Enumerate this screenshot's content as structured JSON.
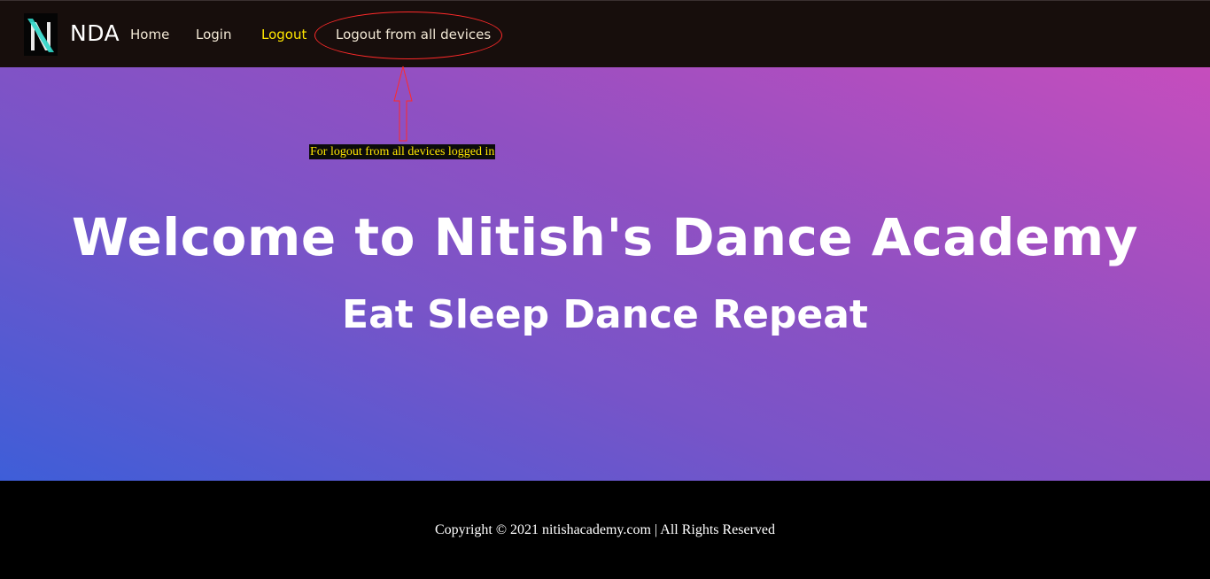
{
  "navbar": {
    "brand": "NDA",
    "logo_letter": "N",
    "links": [
      {
        "label": "Home",
        "active": false
      },
      {
        "label": "Login",
        "active": false
      },
      {
        "label": "Logout",
        "active": true
      },
      {
        "label": "Logout from all devices",
        "active": false
      }
    ]
  },
  "annotation": {
    "note": "For logout from all devices logged in",
    "color": "#ff2a2a"
  },
  "hero": {
    "title": "Welcome to Nitish's Dance Academy",
    "subtitle": "Eat Sleep Dance Repeat",
    "gradient_start": "#3e5ed8",
    "gradient_end": "#c64dbd"
  },
  "footer": {
    "copyright": "Copyright © 2021 nitishacademy.com | All Rights Reserved"
  },
  "colors": {
    "navbar_bg": "#170e0c",
    "active_link": "#ffe600",
    "link": "#f2e8d5",
    "footer_bg": "#000000"
  }
}
